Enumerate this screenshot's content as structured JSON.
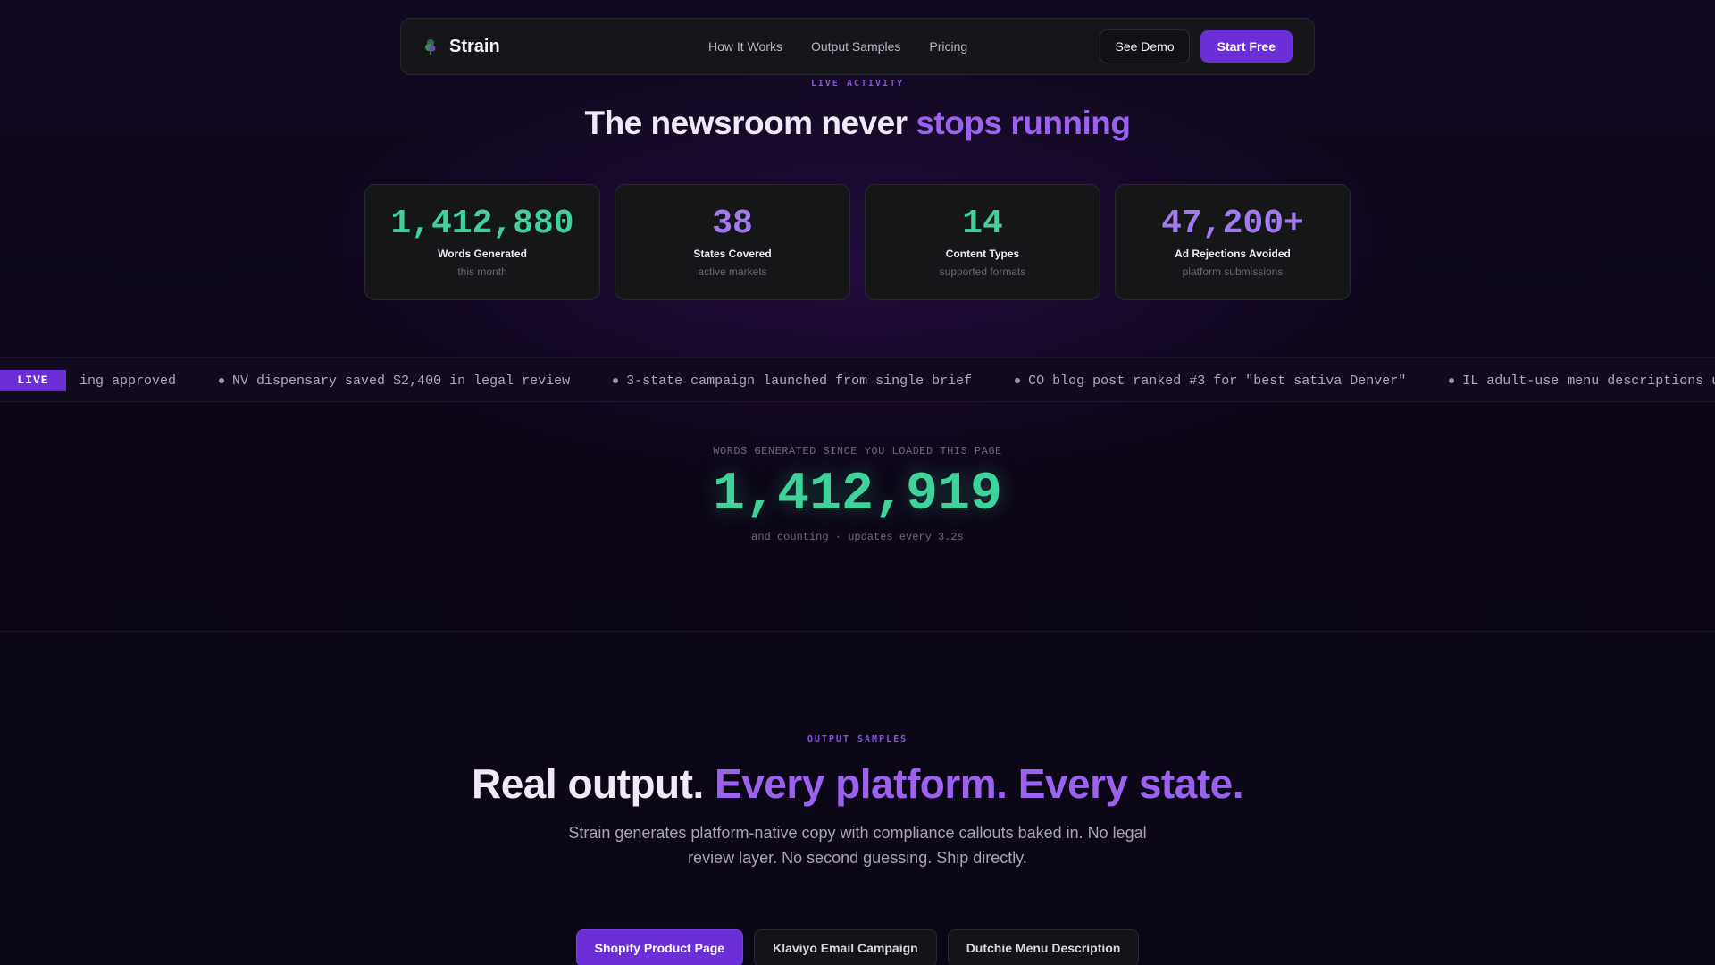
{
  "nav": {
    "brand": "Strain",
    "links": [
      "How It Works",
      "Output Samples",
      "Pricing"
    ],
    "see_demo": "See Demo",
    "start_free": "Start Free"
  },
  "live_section": {
    "eyebrow": "LIVE ACTIVITY",
    "title_main": "The newsroom never ",
    "title_accent": "stops running",
    "stats": [
      {
        "value": "1,412,880",
        "label": "Words Generated",
        "sub": "this month",
        "color": "#3fd29a"
      },
      {
        "value": "38",
        "label": "States Covered",
        "sub": "active markets",
        "color": "#a27af0"
      },
      {
        "value": "14",
        "label": "Content Types",
        "sub": "supported formats",
        "color": "#3fd29a"
      },
      {
        "value": "47,200+",
        "label": "Ad Rejections Avoided",
        "sub": "platform submissions",
        "color": "#a27af0"
      }
    ]
  },
  "ticker": {
    "badge": "LIVE",
    "items": [
      "ing approved",
      "NV dispensary saved $2,400 in legal review",
      "3-state campaign launched from single brief",
      "CO blog post ranked #3 for \"best sativa Denver\"",
      "IL adult-use menu descriptions updated to v"
    ]
  },
  "counter": {
    "label": "WORDS GENERATED SINCE YOU LOADED THIS PAGE",
    "value": "1,412,919",
    "sub": "and counting · updates every 3.2s"
  },
  "samples": {
    "eyebrow": "OUTPUT SAMPLES",
    "title_main": "Real output. ",
    "title_accent": "Every platform. Every state.",
    "description": "Strain generates platform-native copy with compliance callouts baked in. No legal review layer. No second guessing. Ship directly.",
    "tabs": [
      "Shopify Product Page",
      "Klaviyo Email Campaign",
      "Dutchie Menu Description"
    ],
    "active_tab": "Shopify Product Page"
  },
  "colors": {
    "accent_purple": "#6a2fd6",
    "accent_green": "#3fd29a",
    "accent_violet": "#9b62f0"
  }
}
